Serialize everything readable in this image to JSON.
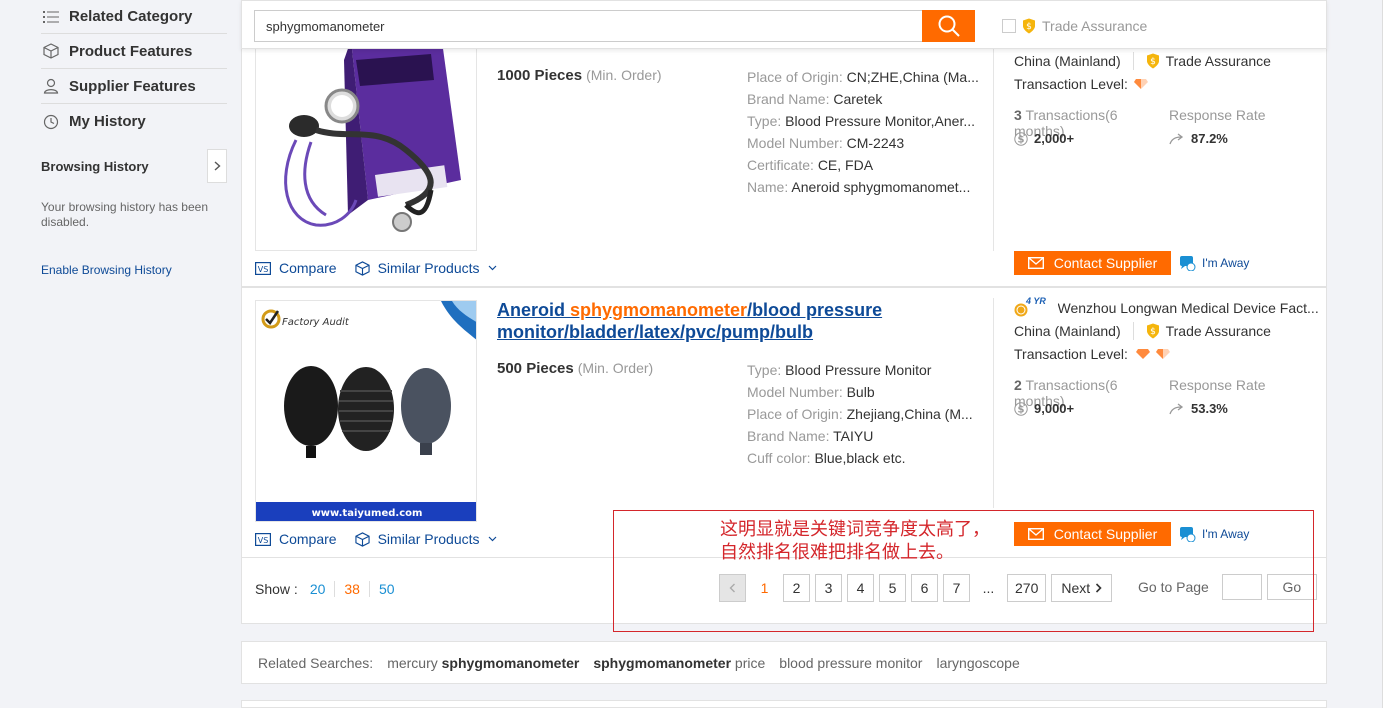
{
  "sidebar": {
    "items": [
      {
        "label": "Related Category",
        "icon": "list-icon"
      },
      {
        "label": "Product Features",
        "icon": "box-icon"
      },
      {
        "label": "Supplier Features",
        "icon": "user-icon"
      },
      {
        "label": "My History",
        "icon": "history-icon"
      }
    ],
    "browsing_title": "Browsing History",
    "browsing_msg": "Your browsing history has been disabled.",
    "enable_link": "Enable Browsing History"
  },
  "search": {
    "value": "sphygmomanometer",
    "trade_assurance": "Trade Assurance"
  },
  "products": [
    {
      "moq": "1000 Pieces",
      "moq_sub": "(Min. Order)",
      "attrs": [
        {
          "k": "Place of Origin:",
          "v": "CN;ZHE,China (Ma..."
        },
        {
          "k": "Brand Name:",
          "v": "Caretek"
        },
        {
          "k": "Type:",
          "v": "Blood Pressure Monitor,Aner..."
        },
        {
          "k": "Model Number:",
          "v": "CM-2243"
        },
        {
          "k": "Certificate:",
          "v": "CE, FDA"
        },
        {
          "k": "Name:",
          "v": "Aneroid sphygmomanomet..."
        }
      ],
      "country": "China (Mainland)",
      "trade_assurance": "Trade Assurance",
      "transaction_level": "Transaction Level:",
      "transactions_count": "3",
      "transactions_label": "Transactions(6 months)",
      "transactions_value": "2,000+",
      "response_label": "Response Rate",
      "response_value": "87.2%",
      "contact": "Contact Supplier",
      "away": "I'm Away",
      "compare": "Compare",
      "similar": "Similar Products"
    },
    {
      "title_pre": "Aneroid ",
      "title_kw": "sphygmomanometer",
      "title_post": "/blood pressure monitor/bladder/latex/pvc/pump/bulb",
      "moq": "500 Pieces",
      "moq_sub": "(Min. Order)",
      "attrs": [
        {
          "k": "Type:",
          "v": "Blood Pressure Monitor"
        },
        {
          "k": "Model Number:",
          "v": "Bulb"
        },
        {
          "k": "Place of Origin:",
          "v": "Zhejiang,China (M..."
        },
        {
          "k": "Brand Name:",
          "v": "TAIYU"
        },
        {
          "k": "Cuff color:",
          "v": "Blue,black etc."
        }
      ],
      "supplier_years": "4 YR",
      "supplier": "Wenzhou Longwan Medical Device Fact...",
      "country": "China (Mainland)",
      "trade_assurance": "Trade Assurance",
      "transaction_level": "Transaction Level:",
      "transactions_count": "2",
      "transactions_label": "Transactions(6 months)",
      "transactions_value": "9,000+",
      "response_label": "Response Rate",
      "response_value": "53.3%",
      "contact": "Contact Supplier",
      "away": "I'm Away",
      "compare": "Compare",
      "similar": "Similar Products",
      "image_badge": "Factory Audit",
      "image_url": "www.taiyumed.com"
    }
  ],
  "pagination": {
    "show_label": "Show :",
    "show_options": [
      "20",
      "38",
      "50"
    ],
    "pages": [
      "1",
      "2",
      "3",
      "4",
      "5",
      "6",
      "7",
      "...",
      "270"
    ],
    "next": "Next",
    "goto_label": "Go to Page",
    "go": "Go"
  },
  "related": {
    "label": "Related Searches:",
    "items": [
      {
        "pre": "mercury ",
        "bold": "sphygmomanometer",
        "post": ""
      },
      {
        "pre": "",
        "bold": "sphygmomanometer",
        "post": " price"
      },
      {
        "pre": "blood pressure monitor",
        "bold": "",
        "post": ""
      },
      {
        "pre": "laryngoscope",
        "bold": "",
        "post": ""
      }
    ]
  },
  "annotation": {
    "line1": "这明显就是关键词竞争度太高了，",
    "line2": "自然排名很难把排名做上去。"
  },
  "colors": {
    "accent": "#ff6a00",
    "link": "#0e4a97",
    "annotation": "#d4262b"
  }
}
